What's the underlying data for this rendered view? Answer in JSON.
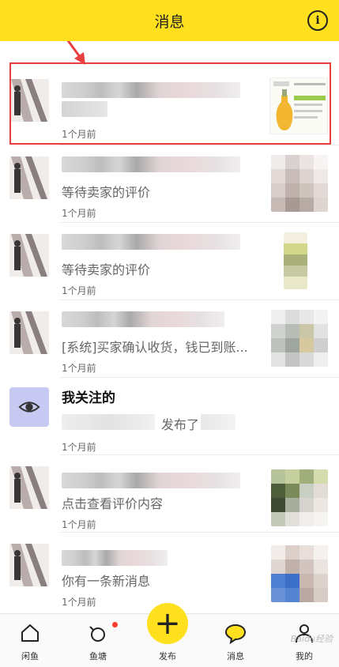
{
  "header": {
    "title": "消息",
    "info_icon_glyph": "i"
  },
  "messages": [
    {
      "preview": "",
      "time": "1个月前"
    },
    {
      "preview": "等待卖家的评价",
      "time": "1个月前"
    },
    {
      "preview": "等待卖家的评价",
      "time": "1个月前"
    },
    {
      "preview": "[系统]买家确认收货，钱已到账...",
      "time": "1个月前"
    },
    {
      "title": "我关注的",
      "preview": "发布了",
      "time": "1个月前"
    },
    {
      "preview": "点击查看评价内容",
      "time": "1个月前"
    },
    {
      "preview": "你有一条新消息",
      "time": "1个月前"
    }
  ],
  "tabbar": {
    "items": [
      {
        "label": "闲鱼",
        "icon": "home-icon"
      },
      {
        "label": "鱼塘",
        "icon": "pond-icon"
      },
      {
        "label": "发布",
        "icon": "plus-icon",
        "glyph": "+"
      },
      {
        "label": "消息",
        "icon": "chat-bubble-icon"
      },
      {
        "label": "我的",
        "icon": "profile-icon"
      }
    ]
  },
  "watermark": "Baidu经验",
  "colors": {
    "brand_yellow": "#ffe01e",
    "highlight_red": "#e83e3e",
    "notification_dot": "#ff3b30",
    "follow_icon_bg": "#c7c9f2"
  }
}
